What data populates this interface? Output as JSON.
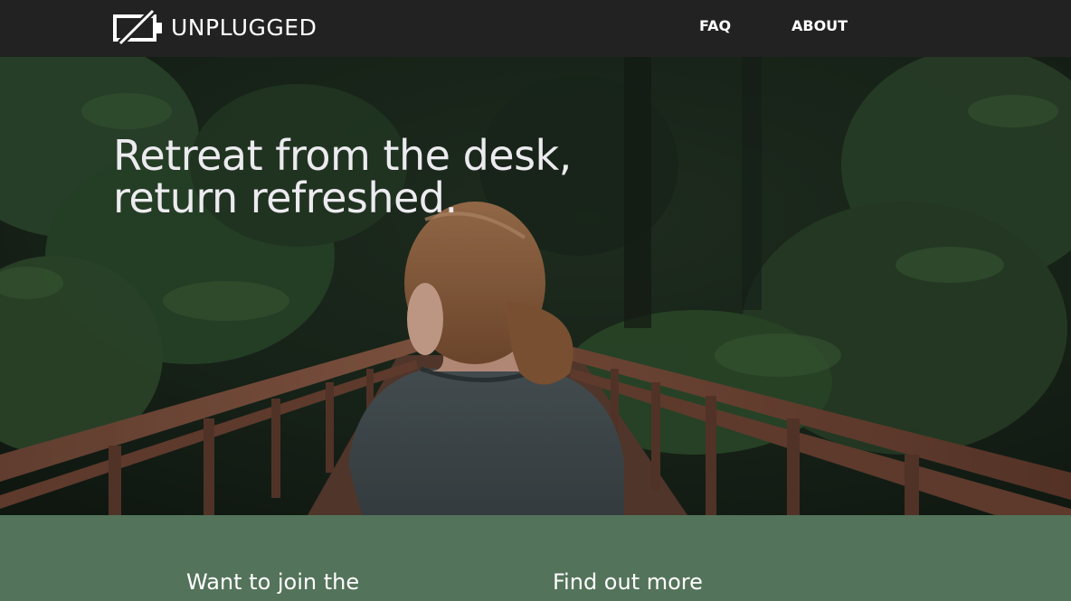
{
  "header": {
    "logo_text": "UNPLUGGED",
    "logo_icon": "unplugged-battery-icon",
    "nav": [
      {
        "label": "FAQ"
      },
      {
        "label": "ABOUT"
      }
    ]
  },
  "hero": {
    "title_line1": "Retreat from the desk,",
    "title_line2": "return refreshed.",
    "image": "woman-on-forest-bridge-photo"
  },
  "lower": {
    "join_heading": "Want to join the",
    "more_heading": "Find out more"
  },
  "colors": {
    "header_bg": "#222222",
    "accent_green": "#53735a",
    "text_light": "#ecebef"
  }
}
